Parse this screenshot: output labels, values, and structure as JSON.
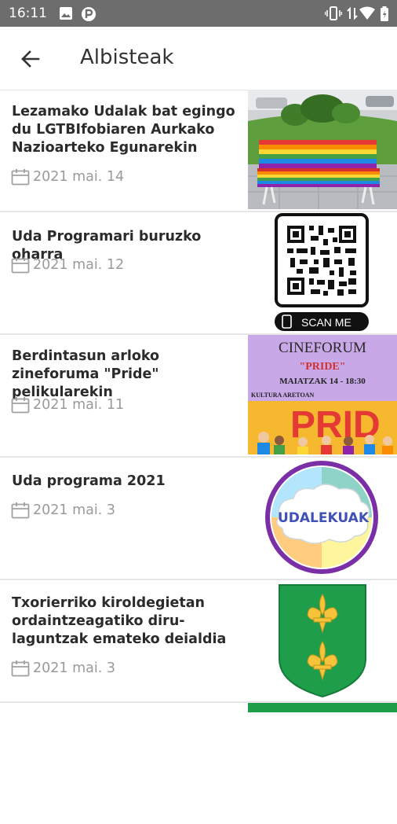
{
  "status": {
    "time": "16:11"
  },
  "app_bar": {
    "title": "Albisteak"
  },
  "articles": [
    {
      "title": "Lezamako Udalak bat egingo du LGTBIfobiaren Aurkako Nazioarteko Egunarekin",
      "date": "2021 mai. 14"
    },
    {
      "title": "Uda Programari buruzko oharra",
      "date": "2021 mai. 12",
      "thumb_label": "SCAN ME"
    },
    {
      "title": "Berdintasun arloko zineforuma \"Pride\" pelikularekin",
      "date": "2021 mai. 11",
      "thumb_lines": [
        "CINEFORUM",
        "\"PRIDE\"",
        "MAIATZAK 14 - 18:30",
        "KULTURA ARETOAN",
        "PRID"
      ]
    },
    {
      "title": "Uda programa 2021",
      "date": "2021 mai. 3",
      "thumb_label": "UDALEKUAK"
    },
    {
      "title": "Txorierriko kiroldegietan ordaintzeagatiko diru-laguntzak emateko deialdia",
      "date": "2021 mai. 3"
    }
  ],
  "colors": {
    "status_bar": "#6d6d6d",
    "date_text": "#9a9a9a",
    "divider": "#e6e6e6"
  }
}
